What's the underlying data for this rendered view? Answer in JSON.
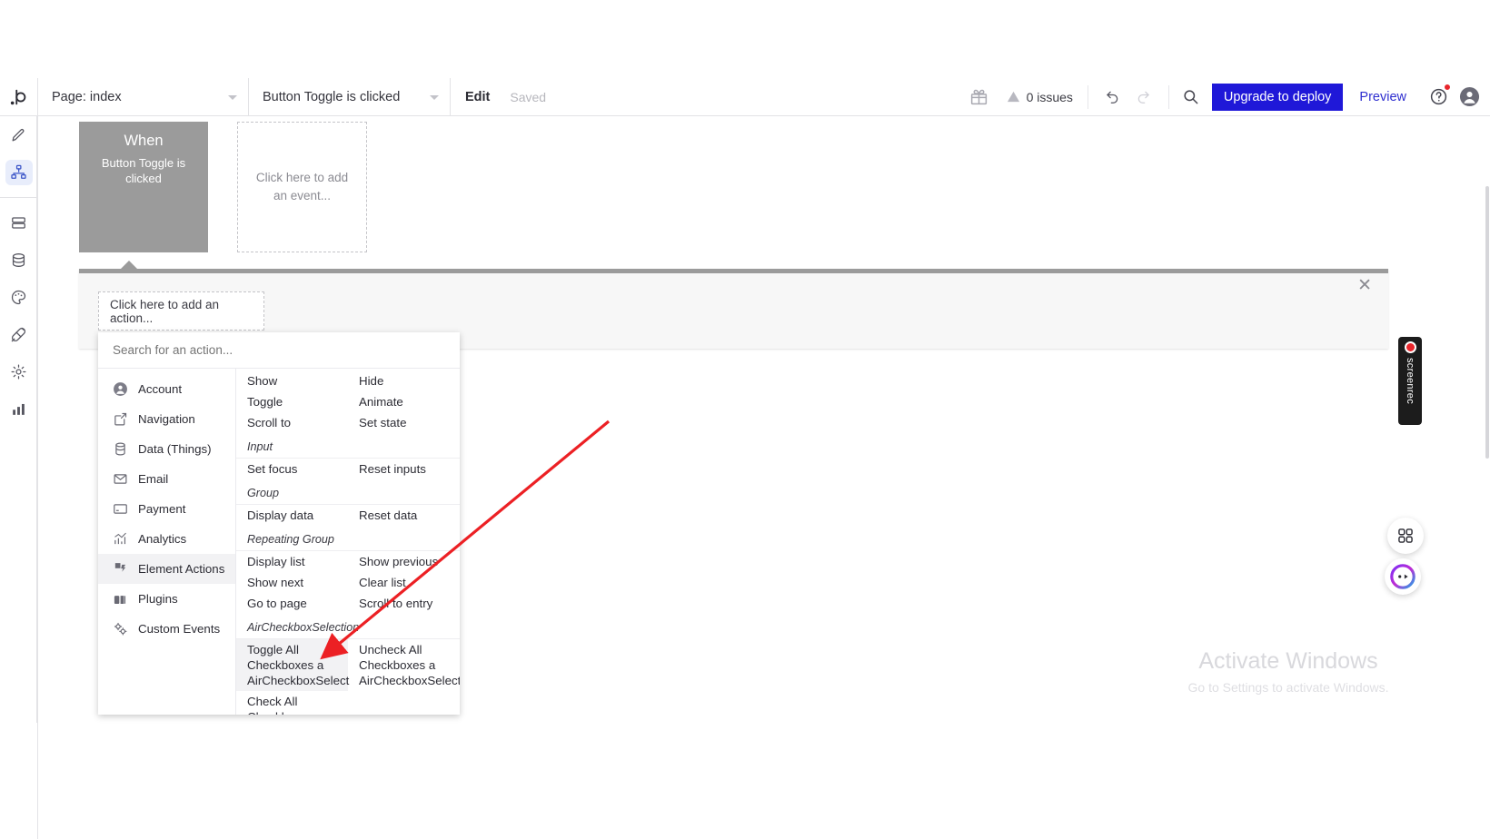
{
  "topbar": {
    "logo": "bubble-logo-icon",
    "page_selector": "Page: index",
    "workflow_selector": "Button Toggle is clicked",
    "edit_label": "Edit",
    "saved_label": "Saved",
    "gift_icon": "gift-icon",
    "issues_count": "0 issues",
    "warning_icon": "warning-triangle-icon",
    "undo_icon": "undo-icon",
    "redo_icon": "redo-icon",
    "search_icon": "search-icon",
    "deploy_button": "Upgrade to deploy",
    "preview_button": "Preview",
    "help_icon": "help-circle-icon",
    "avatar_icon": "user-avatar-icon",
    "deploy_color": "#1f18d8",
    "preview_color": "#2f2fd0"
  },
  "rail": {
    "items": [
      {
        "name": "design",
        "icon": "pencil-icon"
      },
      {
        "name": "workflow",
        "icon": "workflow-nodes-icon"
      },
      {
        "name": "data-pages",
        "icon": "server-stack-icon"
      },
      {
        "name": "database",
        "icon": "database-icon"
      },
      {
        "name": "styles",
        "icon": "palette-icon"
      },
      {
        "name": "plugins",
        "icon": "plug-icon"
      },
      {
        "name": "settings",
        "icon": "gear-icon"
      },
      {
        "name": "logs",
        "icon": "bar-chart-icon"
      }
    ],
    "collapse_icon": "chevron-right-icon"
  },
  "canvas": {
    "when_block": {
      "title": "When",
      "subtitle": "Button Toggle is clicked"
    },
    "add_event": "Click here to add an event...",
    "add_action": "Click here to add an action...",
    "close_icon": "close-icon"
  },
  "dropdown": {
    "search_placeholder": "Search for an action...",
    "search_value": "",
    "categories": [
      {
        "label": "Account",
        "icon": "account-circle-icon",
        "active": false
      },
      {
        "label": "Navigation",
        "icon": "navigation-share-icon",
        "active": false
      },
      {
        "label": "Data (Things)",
        "icon": "database-icon",
        "active": false
      },
      {
        "label": "Email",
        "icon": "envelope-icon",
        "active": false
      },
      {
        "label": "Payment",
        "icon": "credit-card-icon",
        "active": false
      },
      {
        "label": "Analytics",
        "icon": "analytics-chart-icon",
        "active": false
      },
      {
        "label": "Element Actions",
        "icon": "element-actions-icon",
        "active": true
      },
      {
        "label": "Plugins",
        "icon": "plugins-icon",
        "active": false
      },
      {
        "label": "Custom Events",
        "icon": "custom-events-gears-icon",
        "active": false
      }
    ],
    "sections": [
      {
        "group": null,
        "actions": [
          {
            "label": "Show",
            "highlighted": false
          },
          {
            "label": "Hide",
            "highlighted": false
          },
          {
            "label": "Toggle",
            "highlighted": false
          },
          {
            "label": "Animate",
            "highlighted": false
          },
          {
            "label": "Scroll to",
            "highlighted": false
          },
          {
            "label": "Set state",
            "highlighted": false
          }
        ]
      },
      {
        "group": "Input",
        "actions": [
          {
            "label": "Set focus",
            "highlighted": false
          },
          {
            "label": "Reset inputs",
            "highlighted": false
          }
        ]
      },
      {
        "group": "Group",
        "actions": [
          {
            "label": "Display data",
            "highlighted": false
          },
          {
            "label": "Reset data",
            "highlighted": false
          }
        ]
      },
      {
        "group": "Repeating Group",
        "actions": [
          {
            "label": "Display list",
            "highlighted": false
          },
          {
            "label": "Show previous",
            "highlighted": false
          },
          {
            "label": "Show next",
            "highlighted": false
          },
          {
            "label": "Clear list",
            "highlighted": false
          },
          {
            "label": "Go to page",
            "highlighted": false
          },
          {
            "label": "Scroll to entry",
            "highlighted": false
          }
        ]
      },
      {
        "group": "AirCheckboxSelection",
        "actions": [
          {
            "label": "Toggle All Checkboxes a AirCheckboxSelect",
            "highlighted": true
          },
          {
            "label": "Uncheck All Checkboxes a AirCheckboxSelect",
            "highlighted": false
          },
          {
            "label": "Check All Checkboxes a AirCheckboxSelect",
            "highlighted": false
          }
        ]
      }
    ]
  },
  "widgets": {
    "screenrec_label": "screenrec",
    "screenrec_record_icon": "record-dot-icon",
    "grid_fab_icon": "grid-apps-icon",
    "purple_fab_icon": "assistant-face-icon"
  },
  "watermark": {
    "title": "Activate Windows",
    "subtitle": "Go to Settings to activate Windows."
  }
}
